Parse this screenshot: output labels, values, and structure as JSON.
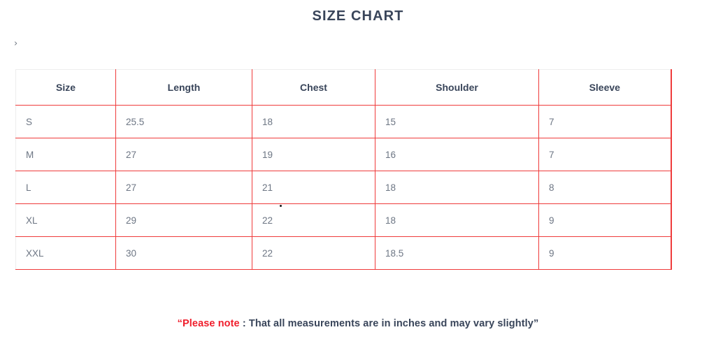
{
  "page": {
    "title": "SIZE CHART",
    "breadcrumb_chevron": "›"
  },
  "colors": {
    "title": "#39455a",
    "border_red": "#ef3b3b",
    "border_gray": "#ededed",
    "header_text": "#39455a",
    "cell_text": "#6d7684",
    "accent_red": "#f01e2c"
  },
  "table": {
    "columns": [
      {
        "key": "size",
        "label": "Size"
      },
      {
        "key": "length",
        "label": "Length"
      },
      {
        "key": "chest",
        "label": "Chest"
      },
      {
        "key": "shoulder",
        "label": "Shoulder"
      },
      {
        "key": "sleeve",
        "label": "Sleeve"
      }
    ],
    "rows": [
      {
        "size": "S",
        "length": "25.5",
        "chest": "18",
        "shoulder": "15",
        "sleeve": "7"
      },
      {
        "size": "M",
        "length": "27",
        "chest": "19",
        "shoulder": "16",
        "sleeve": "7"
      },
      {
        "size": "L",
        "length": "27",
        "chest": "21",
        "shoulder": "18",
        "sleeve": "8"
      },
      {
        "size": "XL",
        "length": "29",
        "chest": "22",
        "shoulder": "18",
        "sleeve": "9"
      },
      {
        "size": "XXL",
        "length": "30",
        "chest": "22",
        "shoulder": "18.5",
        "sleeve": "9"
      }
    ]
  },
  "footer": {
    "quote_open": "“",
    "emphasis": "Please note",
    "rest": " : That all measurements are in inches and may vary slightly",
    "quote_close": "”"
  }
}
